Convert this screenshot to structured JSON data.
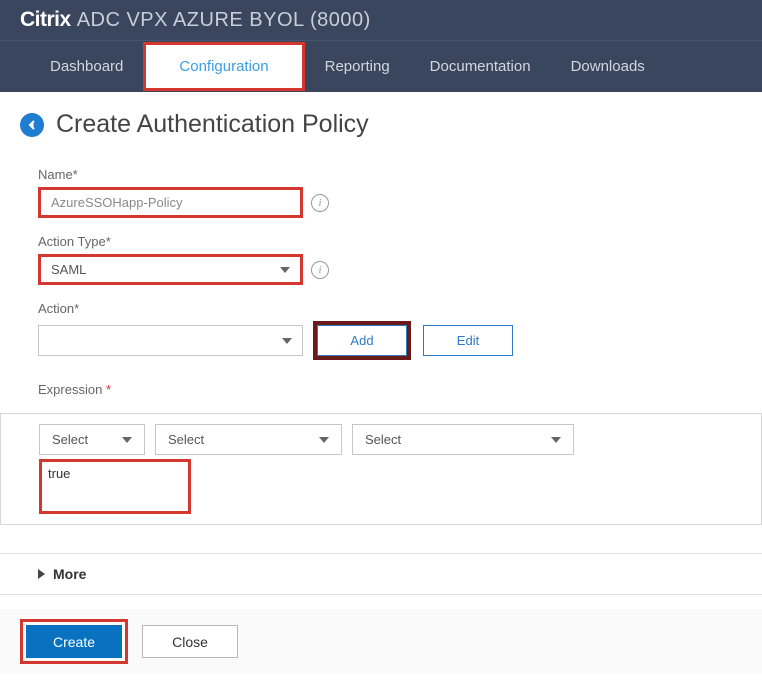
{
  "header": {
    "brand_bold": "Citrix",
    "brand_light": "ADC VPX AZURE BYOL (8000)"
  },
  "nav": {
    "items": [
      {
        "label": "Dashboard",
        "active": false
      },
      {
        "label": "Configuration",
        "active": true
      },
      {
        "label": "Reporting",
        "active": false
      },
      {
        "label": "Documentation",
        "active": false
      },
      {
        "label": "Downloads",
        "active": false
      }
    ]
  },
  "page": {
    "title": "Create Authentication Policy"
  },
  "form": {
    "name": {
      "label": "Name*",
      "value": "AzureSSOHapp-Policy"
    },
    "action_type": {
      "label": "Action Type*",
      "value": "SAML"
    },
    "action": {
      "label": "Action*",
      "value": "",
      "add": "Add",
      "edit": "Edit"
    },
    "expression": {
      "label": "Expression",
      "selects": [
        "Select",
        "Select",
        "Select"
      ],
      "text": "true"
    },
    "more": "More",
    "create": "Create",
    "close": "Close"
  }
}
